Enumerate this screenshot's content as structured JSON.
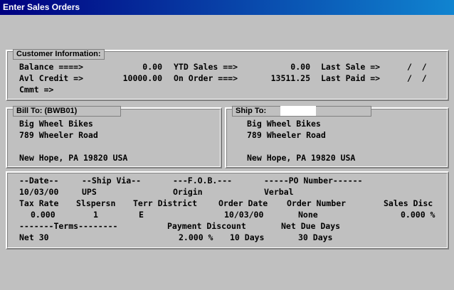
{
  "window": {
    "title": "Enter Sales Orders"
  },
  "customer": {
    "legend": "Customer Information:",
    "balance_label": "Balance ====>",
    "balance_value": "0.00",
    "avl_credit_label": "Avl Credit =>",
    "avl_credit_value": "10000.00",
    "cmmt_label": "Cmmt =>",
    "ytd_sales_label": "YTD Sales ==>",
    "ytd_sales_value": "0.00",
    "on_order_label": "On Order ===>",
    "on_order_value": "13511.25",
    "last_sale_label": "Last Sale =>",
    "last_sale_value": "/  /",
    "last_paid_label": "Last Paid =>",
    "last_paid_value": "/  /"
  },
  "bill_to": {
    "legend": "Bill To: (BWB01)",
    "line1": "Big Wheel Bikes",
    "line2": "789 Wheeler Road",
    "line3": "",
    "line4": "New Hope, PA 19820 USA"
  },
  "ship_to": {
    "legend": "Ship To:",
    "code": "",
    "line1": "Big Wheel Bikes",
    "line2": "789 Wheeler Road",
    "line3": "",
    "line4": "New Hope, PA 19820 USA"
  },
  "order": {
    "date_header": "--Date--",
    "ship_via_header": "--Ship Via--",
    "fob_header": "---F.O.B.---",
    "po_header": "-----PO Number------",
    "date": "10/03/00",
    "ship_via": "UPS",
    "fob": "Origin",
    "po_number": "Verbal",
    "tax_rate_header": "Tax Rate",
    "slspersn_header": "Slspersn",
    "terr_district_header": "Terr District",
    "order_date_header": "Order Date",
    "order_number_header": "Order Number",
    "sales_disc_header": "Sales Disc",
    "tax_rate": "0.000",
    "slspersn": "1",
    "terr_district": "E",
    "order_date": "10/03/00",
    "order_number": "None",
    "sales_disc": "0.000 %",
    "terms_header": "-------Terms--------",
    "payment_discount_header": "Payment Discount",
    "net_due_days_header": "Net Due Days",
    "terms": "Net 30",
    "payment_discount_pct": "2.000 %",
    "payment_discount_days": "10 Days",
    "net_due_days": "30 Days"
  }
}
